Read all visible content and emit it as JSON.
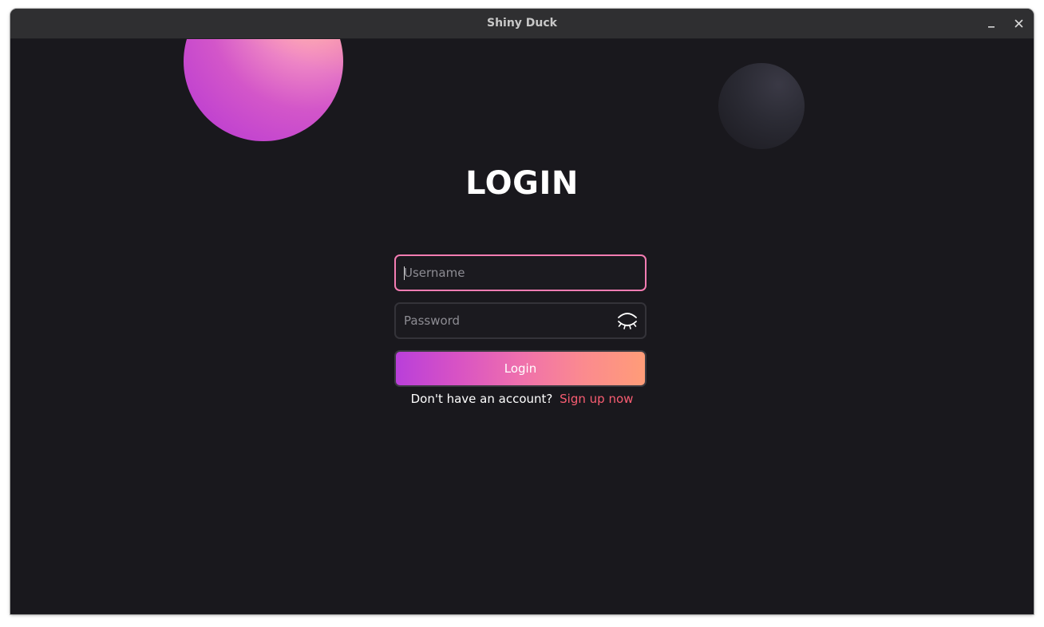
{
  "window": {
    "title": "Shiny Duck",
    "controls": {
      "minimize_icon": "minimize-icon",
      "close_icon": "close-icon"
    }
  },
  "login": {
    "heading": "LOGIN",
    "username": {
      "placeholder": "Username",
      "value": ""
    },
    "password": {
      "placeholder": "Password",
      "value": "",
      "toggle_icon": "eye-closed-icon"
    },
    "submit_label": "Login",
    "signup_prompt": "Don't have an account?",
    "signup_link": "Sign up now"
  },
  "colors": {
    "background": "#19181d",
    "titlebar": "#2f2f31",
    "focus_border": "#f37cb2",
    "gradient_start": "#b93fda",
    "gradient_end": "#ff9c78",
    "link": "#f95d72"
  }
}
